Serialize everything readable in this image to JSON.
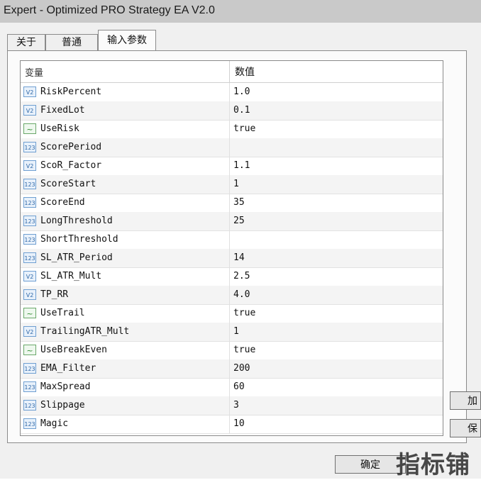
{
  "window": {
    "title": "Expert - Optimized PRO Strategy EA V2.0"
  },
  "tabs": [
    {
      "label": "关于",
      "active": false
    },
    {
      "label": "普通",
      "active": false
    },
    {
      "label": "输入参数",
      "active": true
    }
  ],
  "table": {
    "headers": {
      "name": "变量",
      "value": "数值"
    },
    "rows": [
      {
        "type": "double",
        "icon": "V2",
        "name": "RiskPercent",
        "value": "1.0"
      },
      {
        "type": "double",
        "icon": "V2",
        "name": "FixedLot",
        "value": "0.1"
      },
      {
        "type": "bool",
        "icon": "~",
        "name": "UseRisk",
        "value": "true"
      },
      {
        "type": "int",
        "icon": "123",
        "name": "ScorePeriod",
        "value": ""
      },
      {
        "type": "double",
        "icon": "V2",
        "name": "ScoR_Factor",
        "value": "1.1"
      },
      {
        "type": "int",
        "icon": "123",
        "name": "ScoreStart",
        "value": "1"
      },
      {
        "type": "int",
        "icon": "123",
        "name": "ScoreEnd",
        "value": "35"
      },
      {
        "type": "int",
        "icon": "123",
        "name": "LongThreshold",
        "value": "25"
      },
      {
        "type": "int",
        "icon": "123",
        "name": "ShortThreshold",
        "value": ""
      },
      {
        "type": "int",
        "icon": "123",
        "name": "SL_ATR_Period",
        "value": "14"
      },
      {
        "type": "double",
        "icon": "V2",
        "name": "SL_ATR_Mult",
        "value": "2.5"
      },
      {
        "type": "double",
        "icon": "V2",
        "name": "TP_RR",
        "value": "4.0"
      },
      {
        "type": "bool",
        "icon": "~",
        "name": "UseTrail",
        "value": "true"
      },
      {
        "type": "double",
        "icon": "V2",
        "name": "TrailingATR_Mult",
        "value": "1"
      },
      {
        "type": "bool",
        "icon": "~",
        "name": "UseBreakEven",
        "value": "true"
      },
      {
        "type": "int",
        "icon": "123",
        "name": "EMA_Filter",
        "value": "200"
      },
      {
        "type": "int",
        "icon": "123",
        "name": "MaxSpread",
        "value": "60"
      },
      {
        "type": "int",
        "icon": "123",
        "name": "Slippage",
        "value": "3"
      },
      {
        "type": "int",
        "icon": "123",
        "name": "Magic",
        "value": "10"
      }
    ]
  },
  "buttons": {
    "ok": "确定",
    "side_1": "加",
    "side_2": "保"
  },
  "watermark": "指标铺"
}
